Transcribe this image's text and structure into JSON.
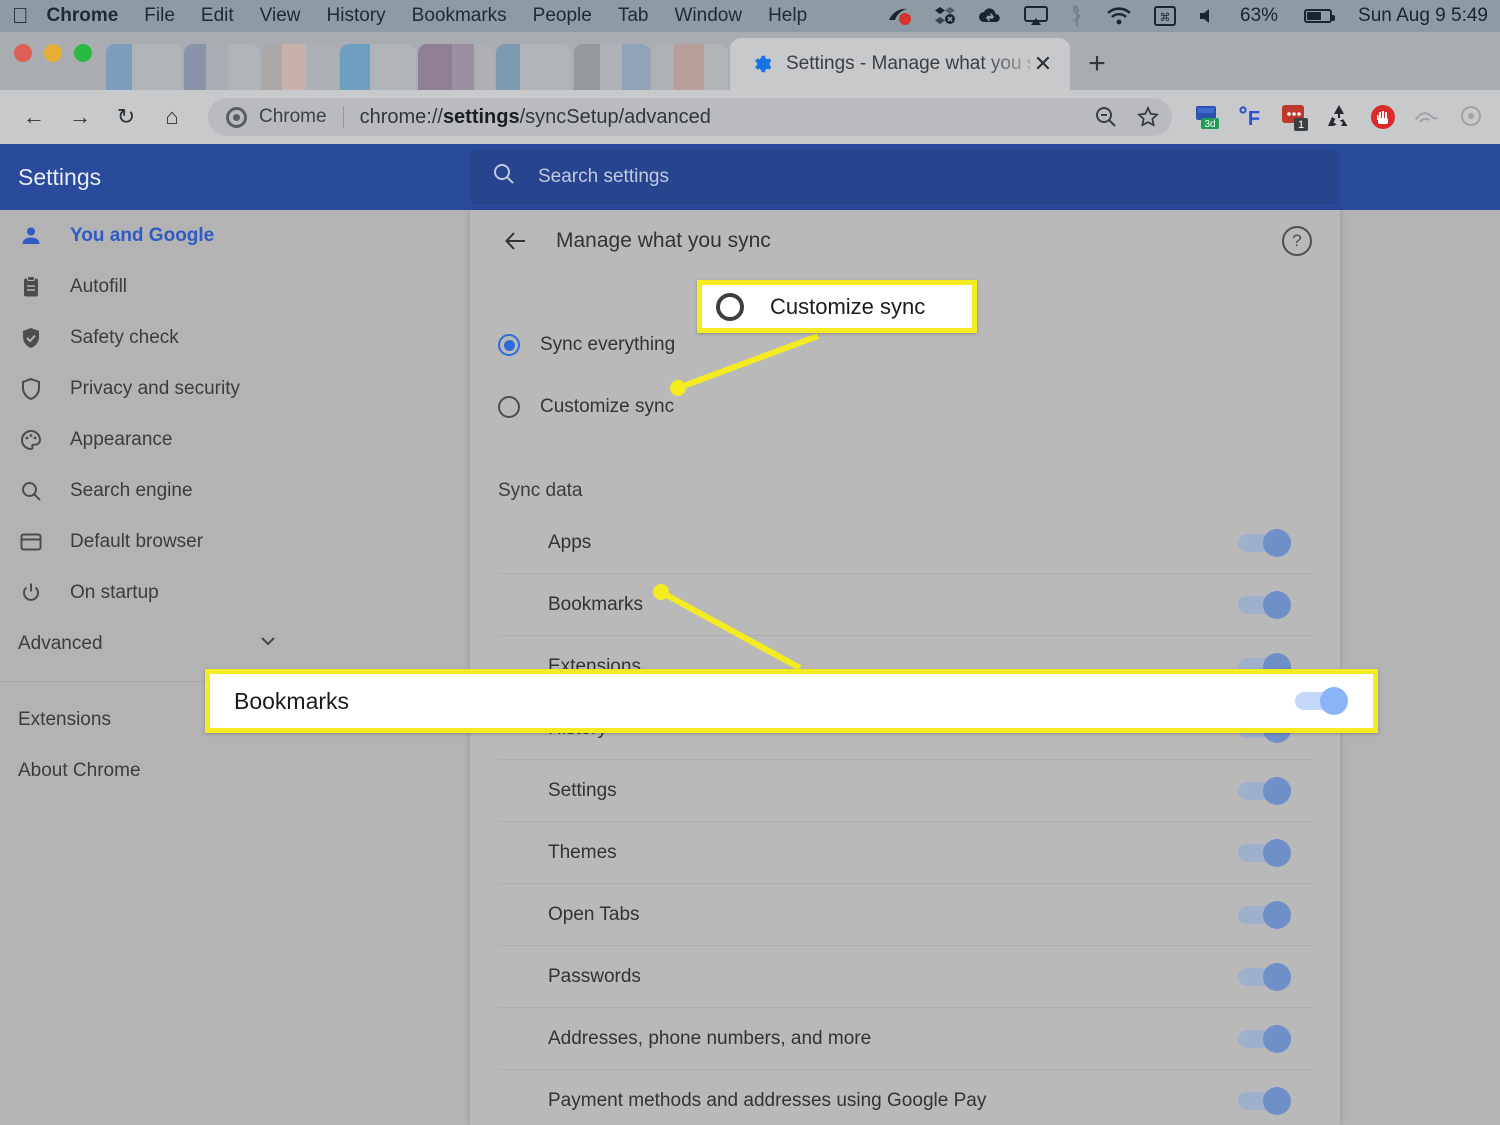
{
  "menubar": {
    "apple_icon": "apple-icon",
    "items": [
      "Chrome",
      "File",
      "Edit",
      "View",
      "History",
      "Bookmarks",
      "People",
      "Tab",
      "Window",
      "Help"
    ],
    "status_icons": [
      "screen-recording-icon",
      "dropbox-icon",
      "cloud-sync-icon",
      "airplay-icon",
      "bluetooth-icon",
      "wifi-icon",
      "keyboard-input-icon",
      "volume-icon"
    ],
    "battery_percent": "63%",
    "clock": "Sun Aug 9  5:49"
  },
  "browser": {
    "tab_title": "Settings - Manage what you sy",
    "tab_favicon": "gear-icon",
    "tab_close": "✕",
    "new_tab": "+",
    "back": "←",
    "forward": "→",
    "reload": "↻",
    "home": "⌂",
    "omnibox": {
      "site_label": "Chrome",
      "url_prefix": "chrome://",
      "url_bold": "settings",
      "url_suffix": "/syncSetup/advanced",
      "zoom_icon": "zoom-search-icon",
      "bookmark_icon": "star-icon"
    },
    "extensions": [
      {
        "name": "3d-capture-extension",
        "label": "3d"
      },
      {
        "name": "temperature-extension",
        "label": "°F"
      },
      {
        "name": "notes-extension",
        "badge": "1"
      },
      {
        "name": "recycle-extension",
        "label": "♻"
      },
      {
        "name": "adblock-extension",
        "label": "✋"
      },
      {
        "name": "faded-extension-1",
        "label": ""
      },
      {
        "name": "faded-extension-2",
        "label": ""
      }
    ]
  },
  "settings": {
    "brand_title": "Settings",
    "search_placeholder": "Search settings",
    "search_icon": "search-icon",
    "accent_blue": "#2a4a9c",
    "sidebar": [
      {
        "label": "You and Google",
        "icon": "person-icon",
        "active": true
      },
      {
        "label": "Autofill",
        "icon": "clipboard-icon",
        "active": false
      },
      {
        "label": "Safety check",
        "icon": "shield-check-icon",
        "active": false
      },
      {
        "label": "Privacy and security",
        "icon": "shield-icon",
        "active": false
      },
      {
        "label": "Appearance",
        "icon": "palette-icon",
        "active": false
      },
      {
        "label": "Search engine",
        "icon": "magnifier-icon",
        "active": false
      },
      {
        "label": "Default browser",
        "icon": "browser-window-icon",
        "active": false
      },
      {
        "label": "On startup",
        "icon": "power-icon",
        "active": false
      }
    ],
    "sidebar_secondary": [
      {
        "label": "Advanced",
        "trailing_icon": "chevron-down-icon"
      },
      {
        "label": "Extensions",
        "trailing_icon": "external-link-icon"
      },
      {
        "label": "About Chrome",
        "trailing_icon": ""
      }
    ]
  },
  "main": {
    "page_title": "Manage what you sync",
    "back_icon": "back-arrow-icon",
    "help_icon": "help-icon",
    "radios": [
      {
        "label": "Sync everything",
        "selected": true
      },
      {
        "label": "Customize sync",
        "selected": false
      }
    ],
    "section_title": "Sync data",
    "sync_items": [
      {
        "label": "Apps",
        "on": true
      },
      {
        "label": "Bookmarks",
        "on": true
      },
      {
        "label": "Extensions",
        "on": true
      },
      {
        "label": "History",
        "on": true
      },
      {
        "label": "Settings",
        "on": true
      },
      {
        "label": "Themes",
        "on": true
      },
      {
        "label": "Open Tabs",
        "on": true
      },
      {
        "label": "Passwords",
        "on": true
      },
      {
        "label": "Addresses, phone numbers, and more",
        "on": true
      },
      {
        "label": "Payment methods and addresses using Google Pay",
        "on": true
      }
    ]
  },
  "annotations": {
    "highlight_color": "#f5eb21",
    "callout_customize_sync": {
      "label": "Customize sync",
      "control": "radio-unselected"
    },
    "callout_bookmarks": {
      "label": "Bookmarks",
      "control": "toggle-on"
    }
  }
}
